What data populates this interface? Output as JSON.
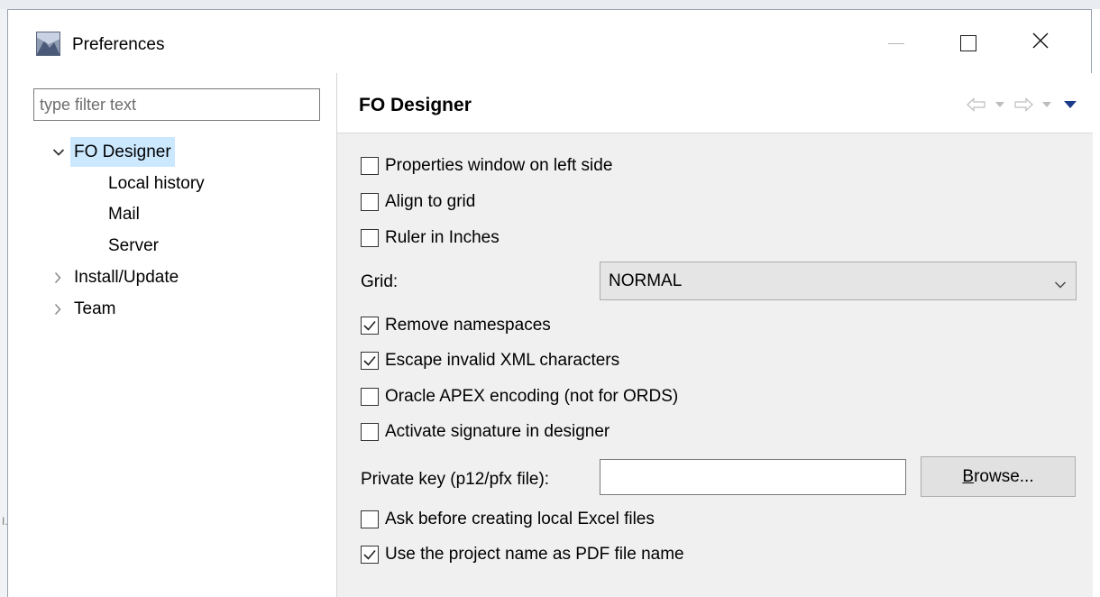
{
  "window": {
    "title": "Preferences",
    "icon": "preferences-app-icon",
    "controls": [
      "minimize-icon",
      "maximize-icon",
      "close-icon"
    ]
  },
  "filter": {
    "placeholder": "type filter text",
    "value": ""
  },
  "tree": {
    "items": [
      {
        "label": "FO Designer",
        "expanded": true,
        "selected": true
      },
      {
        "label": "Local history",
        "child": true
      },
      {
        "label": "Mail",
        "child": true
      },
      {
        "label": "Server",
        "child": true
      },
      {
        "label": "Install/Update",
        "expanded": false
      },
      {
        "label": "Team",
        "expanded": false
      }
    ]
  },
  "page": {
    "title": "FO Designer",
    "nav_icons": [
      "back-arrow-icon",
      "back-dropdown-icon",
      "forward-arrow-icon",
      "forward-dropdown-icon",
      "view-menu-icon"
    ]
  },
  "options": [
    {
      "label": "Properties window on left side",
      "checked": false
    },
    {
      "label": "Align to grid",
      "checked": false
    },
    {
      "label": "Ruler in Inches",
      "checked": false
    },
    {
      "label": "Remove namespaces",
      "checked": true
    },
    {
      "label": "Escape invalid XML characters",
      "checked": true
    },
    {
      "label": "Oracle APEX encoding (not for ORDS)",
      "checked": false
    },
    {
      "label": "Activate signature in designer",
      "checked": false
    },
    {
      "label": "Ask before creating local Excel files",
      "checked": false
    },
    {
      "label": "Use the project name as PDF file name",
      "checked": true
    }
  ],
  "grid": {
    "label": "Grid:",
    "value": "NORMAL"
  },
  "private_key": {
    "label": "Private key (p12/pfx file):",
    "value": "",
    "browse_label_mnemonic": "B",
    "browse_label_rest": "rowse..."
  },
  "colors": {
    "selection": "#cce8ff",
    "page_bg": "#f0f0f0",
    "button_bg": "#e1e1e1",
    "nav_active": "#1b3a8a"
  }
}
